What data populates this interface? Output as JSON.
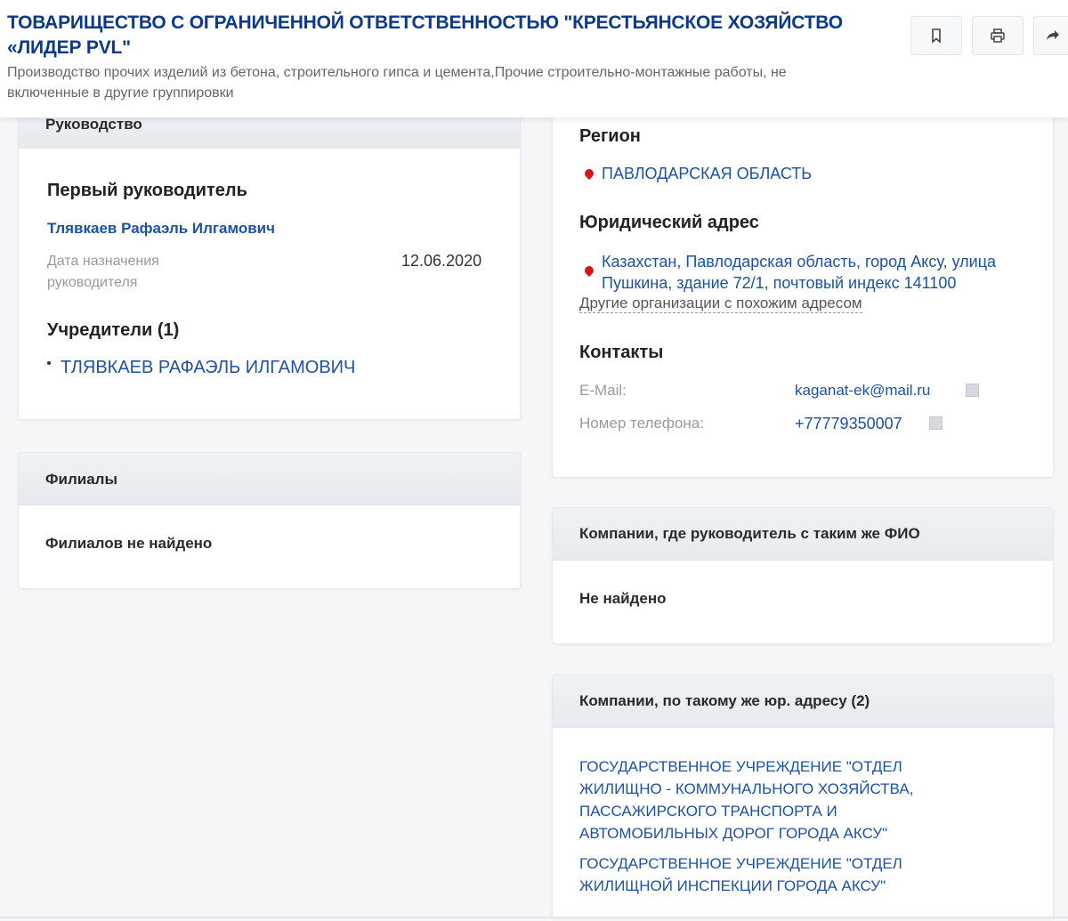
{
  "header": {
    "title": "ТОВАРИЩЕСТВО С ОГРАНИЧЕННОЙ ОТВЕТСТВЕННОСТЬЮ \"КРЕСТЬЯНСКОЕ ХОЗЯЙСТВО «ЛИДЕР PVL\"",
    "activity": "Производство прочих изделий из бетона, строительного гипса и цемента,Прочие строительно-монтажные работы, не включенные в другие группировки",
    "buttons": [
      "bookmark-icon",
      "print-icon",
      "share-icon"
    ]
  },
  "management": {
    "title": "Руководство",
    "first_head_label": "Первый руководитель",
    "first_head_name": "Тлявкаев Рафаэль Илгамович",
    "appointment_label": "Дата назначения руководителя",
    "appointment_date": "12.06.2020",
    "founders_label": "Учредители (1)",
    "founders": [
      "ТЛЯВКАЕВ РАФАЭЛЬ ИЛГАМОВИЧ"
    ]
  },
  "branches": {
    "title": "Филиалы",
    "empty_text": "Филиалов не найдено"
  },
  "info": {
    "region_label": "Регион",
    "region_value": "ПАВЛОДАРСКАЯ ОБЛАСТЬ",
    "address_label": "Юридический адрес",
    "address_value": "Казахстан, Павлодарская область, город Аксу, улица Пушкина, здание 72/1, почтовый индекс 141100",
    "similar_address_link": "Другие организации с похожим адресом",
    "contacts_label": "Контакты",
    "email_label": "E-Mail:",
    "email_value": "kaganat-ek@mail.ru",
    "phone_label": "Номер телефона:",
    "phone_value": "+77779350007"
  },
  "same_head": {
    "title": "Компании, где руководитель с таким же ФИО",
    "empty_text": "Не найдено"
  },
  "same_address": {
    "title": "Компании, по такому же юр. адресу (2)",
    "companies": [
      "ГОСУДАРСТВЕННОЕ УЧРЕЖДЕНИЕ \"ОТДЕЛ ЖИЛИЩНО - КОММУНАЛЬНОГО ХОЗЯЙСТВА, ПАССАЖИРСКОГО ТРАНСПОРТА И АВТОМОБИЛЬНЫХ ДОРОГ ГОРОДА АКСУ\"",
      "ГОСУДАРСТВЕННОЕ УЧРЕЖДЕНИЕ \"ОТДЕЛ ЖИЛИЩНОЙ ИНСПЕКЦИИ ГОРОДА АКСУ\""
    ]
  }
}
